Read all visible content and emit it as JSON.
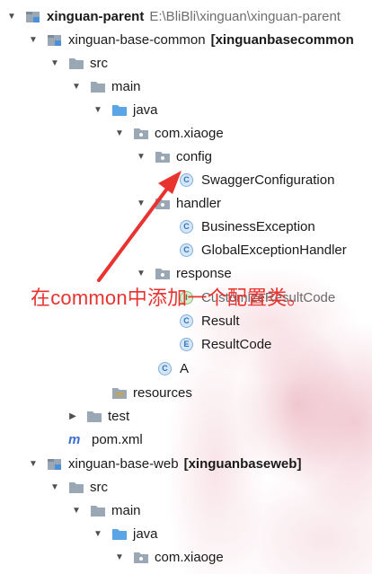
{
  "tree": [
    {
      "label": "xinguan-parent",
      "path": "E:\\BliBli\\xinguan\\xinguan-parent",
      "icon": "module-icon",
      "arrow": "down"
    },
    {
      "label": "xinguan-base-common",
      "suffix": "[xinguanbasecommon",
      "icon": "module-icon",
      "arrow": "down"
    },
    {
      "label": "src",
      "icon": "folder-icon",
      "arrow": "down"
    },
    {
      "label": "main",
      "icon": "folder-icon",
      "arrow": "down"
    },
    {
      "label": "java",
      "icon": "source-folder-icon",
      "arrow": "down"
    },
    {
      "label": "com.xiaoge",
      "icon": "package-icon",
      "arrow": "down"
    },
    {
      "label": "config",
      "icon": "package-icon",
      "arrow": "down"
    },
    {
      "label": "SwaggerConfiguration",
      "icon": "class-icon",
      "arrow": "none"
    },
    {
      "label": "handler",
      "icon": "package-icon",
      "arrow": "down"
    },
    {
      "label": "BusinessException",
      "icon": "class-icon",
      "arrow": "none"
    },
    {
      "label": "GlobalExceptionHandler",
      "icon": "class-icon",
      "arrow": "none"
    },
    {
      "label": "response",
      "icon": "package-icon",
      "arrow": "down"
    },
    {
      "label": "CustomizeResultCode",
      "icon": "interface-icon",
      "arrow": "none"
    },
    {
      "label": "Result",
      "icon": "class-icon",
      "arrow": "none"
    },
    {
      "label": "ResultCode",
      "icon": "enum-icon",
      "arrow": "none"
    },
    {
      "label": "A",
      "icon": "class-icon",
      "arrow": "none"
    },
    {
      "label": "resources",
      "icon": "resources-folder-icon",
      "arrow": "none"
    },
    {
      "label": "test",
      "icon": "folder-icon",
      "arrow": "right"
    },
    {
      "label": "pom.xml",
      "icon": "maven-icon",
      "arrow": "none"
    },
    {
      "label": "xinguan-base-web",
      "suffix": "[xinguanbaseweb]",
      "icon": "module-icon",
      "arrow": "down"
    },
    {
      "label": "src",
      "icon": "folder-icon",
      "arrow": "down"
    },
    {
      "label": "main",
      "icon": "folder-icon",
      "arrow": "down"
    },
    {
      "label": "java",
      "icon": "source-folder-icon",
      "arrow": "down"
    },
    {
      "label": "com.xiaoge",
      "icon": "package-icon",
      "arrow": "down"
    }
  ],
  "icon_letters": {
    "class": "C",
    "interface": "I",
    "enum": "E",
    "maven": "m"
  },
  "annotation": {
    "text": "在common中添加一个配置类。",
    "color": "#e8332f"
  }
}
